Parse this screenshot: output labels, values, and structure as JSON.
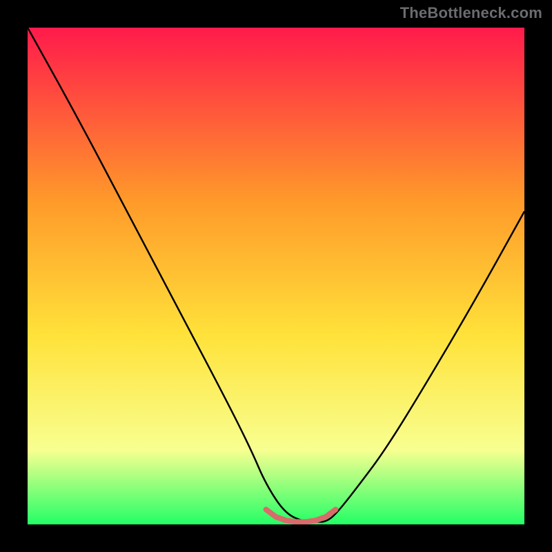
{
  "watermark": "TheBottleneck.com",
  "colors": {
    "gradient_top": "#ff1a4b",
    "gradient_mid1": "#ff9a2a",
    "gradient_mid2": "#ffe23a",
    "gradient_mid3": "#f8ff90",
    "gradient_bottom": "#23ff66",
    "curve": "#000000",
    "marker": "#d86b6b"
  },
  "chart_data": {
    "type": "line",
    "title": "",
    "xlabel": "",
    "ylabel": "",
    "xlim": [
      0,
      100
    ],
    "ylim": [
      0,
      100
    ],
    "series": [
      {
        "name": "curve",
        "x": [
          0,
          10,
          20,
          30,
          40,
          45,
          48,
          52,
          56,
          58,
          60,
          62,
          66,
          72,
          80,
          90,
          100
        ],
        "y": [
          100,
          82,
          63,
          44,
          25,
          15,
          8,
          2,
          0.5,
          0.5,
          0.5,
          2,
          7,
          15,
          28,
          45,
          63
        ]
      },
      {
        "name": "highlight-band",
        "x": [
          48,
          50,
          52,
          54,
          56,
          58,
          60,
          62
        ],
        "y": [
          3,
          1.5,
          0.8,
          0.5,
          0.5,
          0.8,
          1.5,
          3
        ]
      }
    ]
  }
}
